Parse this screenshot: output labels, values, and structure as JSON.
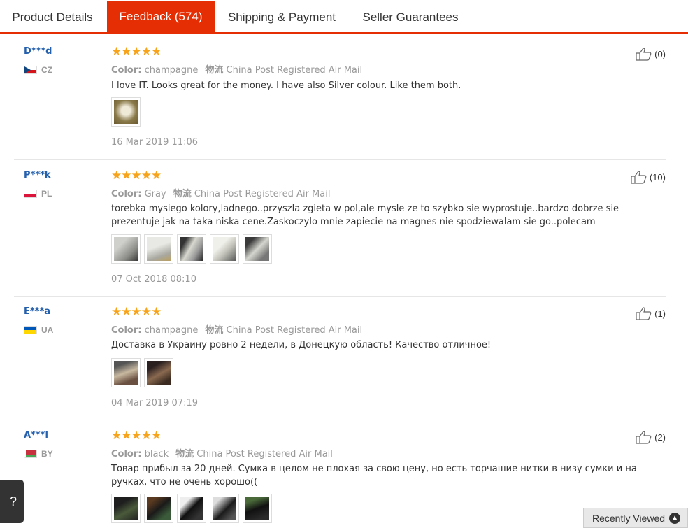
{
  "tabs": [
    {
      "label": "Product Details"
    },
    {
      "label": "Feedback (574)"
    },
    {
      "label": "Shipping & Payment"
    },
    {
      "label": "Seller Guarantees"
    }
  ],
  "reviews": [
    {
      "user": "D***d",
      "country": "CZ",
      "stars": "★★★★★",
      "color_label": "Color:",
      "color": "champagne",
      "shipping_label": "物流",
      "shipping": "China Post Registered Air Mail",
      "text": "I love IT. Looks great for the money. I have also Silver colour. Like them both.",
      "date": "16 Mar 2019 11:06",
      "helpful": "(0)"
    },
    {
      "user": "P***k",
      "country": "PL",
      "stars": "★★★★★",
      "color_label": "Color:",
      "color": "Gray",
      "shipping_label": "物流",
      "shipping": "China Post Registered Air Mail",
      "text": "torebka mysiego kolory,ladnego..przyszla zgieta w pol,ale mysle ze to szybko sie wyprostuje..bardzo dobrze sie prezentuje jak na taka niska cene.Zaskoczylo mnie zapiecie na magnes nie spodziewalam sie go..polecam",
      "date": "07 Oct 2018 08:10",
      "helpful": "(10)"
    },
    {
      "user": "E***a",
      "country": "UA",
      "stars": "★★★★★",
      "color_label": "Color:",
      "color": "champagne",
      "shipping_label": "物流",
      "shipping": "China Post Registered Air Mail",
      "text": "Доставка в Украину ровно 2 недели, в Донецкую область! Качество отличное!",
      "date": "04 Mar 2019 07:19",
      "helpful": "(1)"
    },
    {
      "user": "A***l",
      "country": "BY",
      "stars": "★★★★★",
      "color_label": "Color:",
      "color": "black",
      "shipping_label": "物流",
      "shipping": "China Post Registered Air Mail",
      "text": "Товар прибыл за 20 дней. Сумка в целом не плохая за свою цену, но есть торчашие нитки в низу сумки и на ручках, что не очень хорошо((",
      "date": "",
      "helpful": "(2)"
    }
  ],
  "side_widget": {
    "label": "? 1"
  },
  "recently_viewed": {
    "label": "Recently Viewed"
  },
  "colors": {
    "accent": "#e62e04",
    "star": "#f7a41b",
    "user_link": "#2560ad"
  }
}
